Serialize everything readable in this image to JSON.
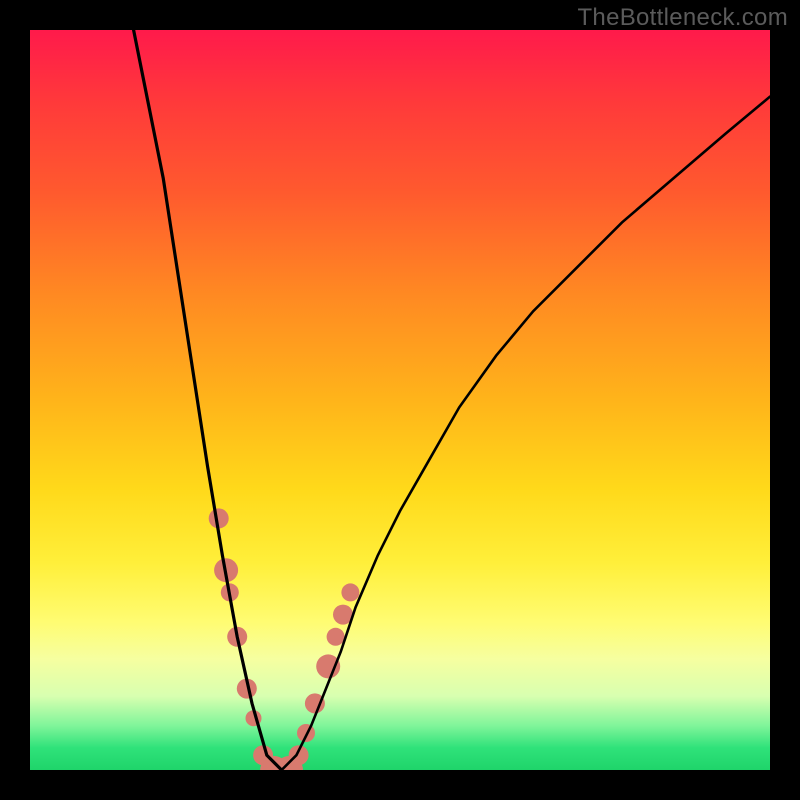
{
  "watermark": "TheBottleneck.com",
  "colors": {
    "background": "#000000",
    "curve": "#000000",
    "markers": "#d87a6e",
    "gradient_top": "#ff1a4b",
    "gradient_bottom": "#1fd46a"
  },
  "chart_data": {
    "type": "line",
    "title": "",
    "xlabel": "",
    "ylabel": "",
    "xlim": [
      0,
      100
    ],
    "ylim": [
      0,
      100
    ],
    "grid": false,
    "legend": false,
    "description": "V-shaped bottleneck curve: two branches descend from top edge, meet near x≈32, then right branch rises toward upper-right. Salmon markers highlight the low (green/optimal) region on both branches near the trough.",
    "series": [
      {
        "name": "left-branch",
        "x": [
          14,
          16,
          18,
          20,
          22,
          24,
          26,
          28,
          30,
          32,
          34
        ],
        "values": [
          100,
          90,
          80,
          67,
          54,
          41,
          29,
          18,
          9,
          2,
          0
        ]
      },
      {
        "name": "right-branch",
        "x": [
          34,
          36,
          38,
          40,
          42,
          44,
          47,
          50,
          54,
          58,
          63,
          68,
          74,
          80,
          87,
          94,
          100
        ],
        "values": [
          0,
          2,
          6,
          11,
          16,
          22,
          29,
          35,
          42,
          49,
          56,
          62,
          68,
          74,
          80,
          86,
          91
        ]
      }
    ],
    "markers": {
      "name": "optimal-zone-points",
      "x": [
        25.5,
        26.5,
        27.0,
        28.0,
        29.3,
        30.2,
        31.5,
        33.0,
        35.0,
        36.3,
        37.3,
        38.5,
        40.3,
        41.3,
        42.3,
        43.3
      ],
      "values": [
        34,
        27,
        24,
        18,
        11,
        7,
        2,
        0,
        0,
        2,
        5,
        9,
        14,
        18,
        21,
        24
      ],
      "r": [
        10,
        12,
        9,
        10,
        10,
        8,
        10,
        14,
        14,
        10,
        9,
        10,
        12,
        9,
        10,
        9
      ]
    }
  }
}
